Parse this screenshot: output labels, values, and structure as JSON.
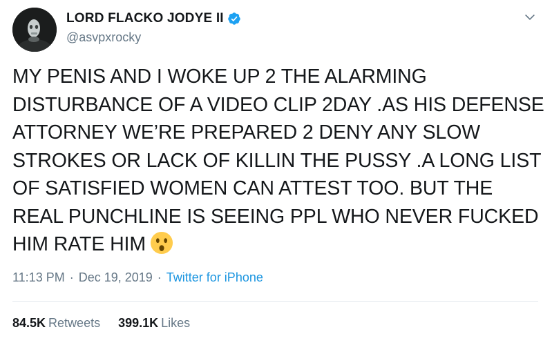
{
  "author": {
    "display_name": "LORD FLACKO JODYE II",
    "handle": "@asvpxrocky",
    "verified": true
  },
  "tweet": {
    "text": "MY PENIS AND I WOKE UP 2 THE ALARMING DISTURBANCE OF A VIDEO CLIP 2DAY .AS HIS DEFENSE ATTORNEY WE’RE PREPARED 2 DENY ANY SLOW STROKES OR LACK OF KILLIN THE PUSSY .A LONG LIST OF SATISFIED WOMEN CAN ATTEST TOO. BUT THE REAL PUNCHLINE IS SEEING PPL WHO NEVER FUCKED HIM RATE HIM",
    "emoji": "hushed-face"
  },
  "meta": {
    "time": "11:13 PM",
    "separator": "·",
    "date": "Dec 19, 2019",
    "source": "Twitter for iPhone"
  },
  "stats": {
    "retweets_count": "84.5K",
    "retweets_label": "Retweets",
    "likes_count": "399.1K",
    "likes_label": "Likes"
  },
  "icons": {
    "verified": "verified-badge-icon",
    "menu": "chevron-down-icon"
  },
  "colors": {
    "text": "#14171a",
    "secondary": "#657786",
    "link": "#1b95e0",
    "verified": "#1da1f2",
    "divider": "#e1e8ed"
  }
}
